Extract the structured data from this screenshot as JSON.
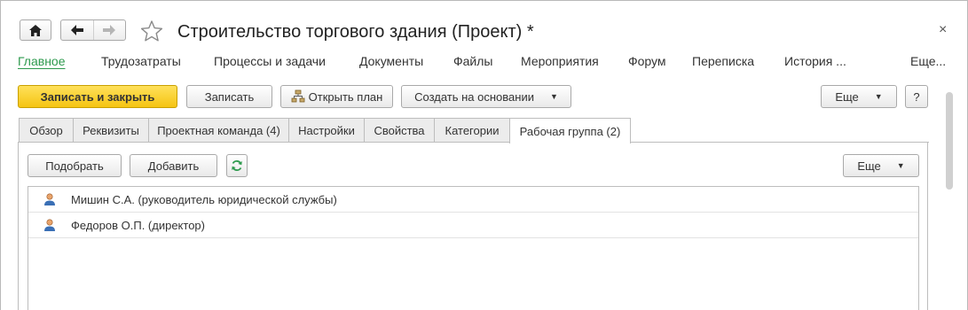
{
  "window": {
    "title": "Строительство торгового здания (Проект) *",
    "close_label": "×"
  },
  "sections": [
    {
      "label": "Главное",
      "active": true
    },
    {
      "label": "Трудозатраты"
    },
    {
      "label": "Процессы и задачи"
    },
    {
      "label": "Документы"
    },
    {
      "label": "Файлы"
    },
    {
      "label": "Мероприятия"
    },
    {
      "label": "Форум"
    },
    {
      "label": "Переписка"
    },
    {
      "label": "История ..."
    },
    {
      "label": "Еще..."
    }
  ],
  "toolbar": {
    "save_close": "Записать и закрыть",
    "save": "Записать",
    "open_plan": "Открыть план",
    "create_based": "Создать на основании",
    "more": "Еще",
    "help": "?"
  },
  "tabs": [
    {
      "label": "Обзор"
    },
    {
      "label": "Реквизиты"
    },
    {
      "label": "Проектная команда (4)"
    },
    {
      "label": "Настройки"
    },
    {
      "label": "Свойства"
    },
    {
      "label": "Категории"
    },
    {
      "label": "Рабочая группа (2)",
      "active": true
    }
  ],
  "group": {
    "pick": "Подобрать",
    "add": "Добавить",
    "more": "Еще",
    "members": [
      "Мишин С.А. (руководитель юридической службы)",
      "Федоров О.П. (директор)"
    ]
  },
  "colors": {
    "accent_green": "#2e9a4e",
    "primary_yellow": "#f5c412"
  }
}
